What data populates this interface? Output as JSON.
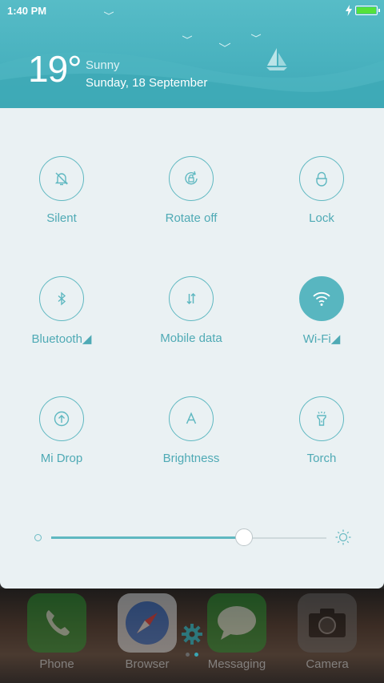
{
  "status": {
    "time": "1:40 PM"
  },
  "weather": {
    "temperature": "19°",
    "condition": "Sunny",
    "date": "Sunday, 18 September"
  },
  "toggles": [
    {
      "label": "Silent",
      "icon": "bell-off-icon",
      "active": false
    },
    {
      "label": "Rotate off",
      "icon": "rotate-lock-icon",
      "active": false
    },
    {
      "label": "Lock",
      "icon": "lock-icon",
      "active": false
    },
    {
      "label": "Bluetooth◢",
      "icon": "bluetooth-icon",
      "active": false
    },
    {
      "label": "Mobile data",
      "icon": "mobile-data-icon",
      "active": false
    },
    {
      "label": "Wi-Fi◢",
      "icon": "wifi-icon",
      "active": true
    },
    {
      "label": "Mi Drop",
      "icon": "mi-drop-icon",
      "active": false
    },
    {
      "label": "Brightness",
      "icon": "brightness-auto-icon",
      "active": false
    },
    {
      "label": "Torch",
      "icon": "torch-icon",
      "active": false
    }
  ],
  "brightness": {
    "level": 0.7
  },
  "dock": {
    "apps": [
      {
        "label": "Phone",
        "icon": "phone-icon"
      },
      {
        "label": "Browser",
        "icon": "compass-icon"
      },
      {
        "label": "Messaging",
        "icon": "message-bubble-icon"
      },
      {
        "label": "Camera",
        "icon": "camera-icon"
      }
    ]
  },
  "colors": {
    "accent": "#5fb8c1",
    "header": "#49b2bf",
    "panel": "#eaf1f3"
  }
}
